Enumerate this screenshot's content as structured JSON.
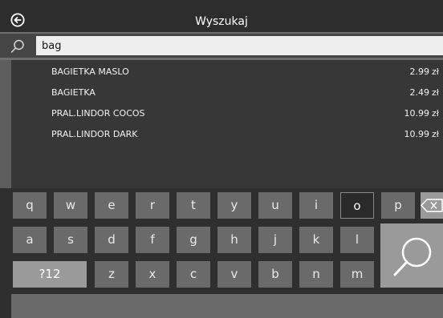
{
  "header": {
    "title": "Wyszukaj"
  },
  "search": {
    "value": "bag"
  },
  "results": [
    {
      "name": "BAGIETKA MASLO",
      "price": "2.99",
      "currency": "zł"
    },
    {
      "name": "BAGIETKA",
      "price": "2.49",
      "currency": "zł"
    },
    {
      "name": "PRAL.LINDOR COCOS",
      "price": "10.99",
      "currency": "zł"
    },
    {
      "name": "PRAL.LINDOR DARK",
      "price": "10.99",
      "currency": "zł"
    }
  ],
  "keyboard": {
    "row1": [
      "q",
      "w",
      "e",
      "r",
      "t",
      "y",
      "u",
      "i",
      "o",
      "p"
    ],
    "row2": [
      "a",
      "s",
      "d",
      "f",
      "g",
      "h",
      "j",
      "k",
      "l"
    ],
    "row3_mode": "?12",
    "row3": [
      "z",
      "x",
      "c",
      "v",
      "b",
      "n",
      "m"
    ],
    "selected_key": "o",
    "backspace_icon": "backspace-icon",
    "search_icon": "search-icon"
  },
  "colors": {
    "background": "#2f2f2f",
    "key": "#6a6a6a",
    "accent_key": "#9a9a9a"
  }
}
